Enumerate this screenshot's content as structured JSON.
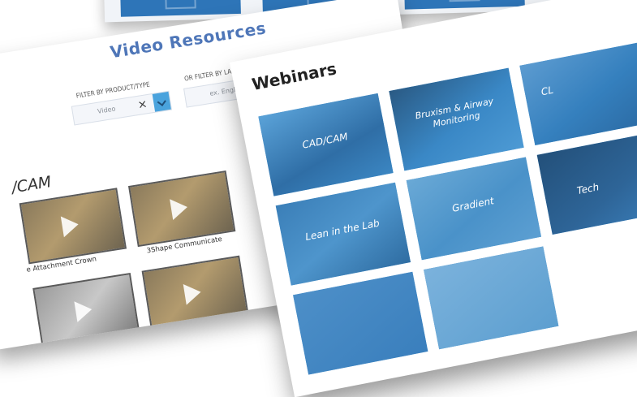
{
  "video_resources": {
    "title": "Video Resources",
    "filter_product_label": "FILTER BY PRODUCT/TYPE",
    "filter_product_value": "Video",
    "filter_language_label": "OR FILTER BY LANGUAGE",
    "filter_language_value": "ex. English",
    "section_heading": "/CAM",
    "video_captions": [
      "e Attachment Crown",
      "3Shape Communicate"
    ]
  },
  "webinars": {
    "title": "Webinars",
    "tiles": [
      "CAD/CAM",
      "Bruxism & Airway Monitoring",
      "CL",
      "Lean in the Lab",
      "Gradient",
      "Tech"
    ]
  },
  "colors": {
    "tile_blue": "#3d8ecc",
    "title_blue": "#4e76b8",
    "chevron_blue": "#4aa3dd"
  }
}
